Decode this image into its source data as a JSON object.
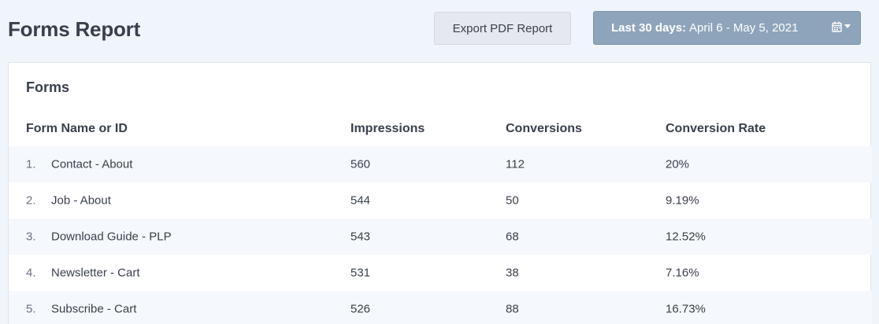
{
  "header": {
    "title": "Forms Report",
    "export_label": "Export PDF Report",
    "date_range_label": "Last 30 days:",
    "date_range_value": "April 6 - May 5, 2021",
    "calendar_icon": "calendar-icon",
    "dropdown_icon": "caret-down-icon"
  },
  "card": {
    "title": "Forms",
    "columns": {
      "name": "Form Name or ID",
      "impressions": "Impressions",
      "conversions": "Conversions",
      "rate": "Conversion Rate"
    },
    "rows": [
      {
        "index": "1.",
        "name": "Contact - About",
        "impressions": "560",
        "conversions": "112",
        "rate": "20%"
      },
      {
        "index": "2.",
        "name": "Job - About",
        "impressions": "544",
        "conversions": "50",
        "rate": "9.19%"
      },
      {
        "index": "3.",
        "name": "Download Guide - PLP",
        "impressions": "543",
        "conversions": "68",
        "rate": "12.52%"
      },
      {
        "index": "4.",
        "name": "Newsletter - Cart",
        "impressions": "531",
        "conversions": "38",
        "rate": "7.16%"
      },
      {
        "index": "5.",
        "name": "Subscribe - Cart",
        "impressions": "526",
        "conversions": "88",
        "rate": "16.73%"
      }
    ]
  },
  "colors": {
    "background": "#f0f4fb",
    "date_button": "#8ea4bb",
    "export_button": "#e5e9ef",
    "text": "#393f4c",
    "row_alt": "#f5f8fc"
  }
}
